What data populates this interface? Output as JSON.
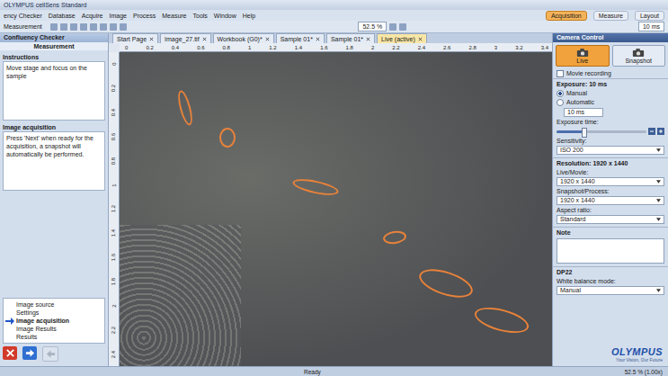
{
  "window": {
    "title": "OLYMPUS cellSens Standard"
  },
  "menu": [
    "ency Checker",
    "Database",
    "Acquire",
    "Image",
    "Process",
    "Measure",
    "Tools",
    "Window",
    "Help"
  ],
  "layout_tabs": [
    {
      "label": "Acquisition",
      "selected": true
    },
    {
      "label": "Measure",
      "selected": false
    },
    {
      "label": "Layout",
      "selected": false
    }
  ],
  "toolbar": {
    "label": "Measurement",
    "zoom": "52.5 %",
    "exposure": "10 ms"
  },
  "left_panel": {
    "title": "Confluency Checker",
    "subtitle": "Measurement",
    "sections": [
      {
        "heading": "Instructions",
        "text": "Move stage and focus on the sample"
      },
      {
        "heading": "Image acquisition",
        "text": "Press 'Next' when ready for the acquisition, a snapshot will automatically be performed."
      }
    ],
    "steps": [
      {
        "label": "Image source",
        "selected": false
      },
      {
        "label": "Settings",
        "selected": false
      },
      {
        "label": "Image acquisition",
        "selected": true
      },
      {
        "label": "Image Results",
        "selected": false
      },
      {
        "label": "Results",
        "selected": false
      }
    ],
    "nav_buttons": [
      {
        "kind": "cancel",
        "disabled": false
      },
      {
        "kind": "next",
        "disabled": false
      },
      {
        "kind": "back",
        "disabled": true
      }
    ]
  },
  "doc_tabs": [
    {
      "label": "Start Page",
      "selected": false
    },
    {
      "label": "Image_27.tif",
      "selected": false
    },
    {
      "label": "Workbook (G0)*",
      "selected": false
    },
    {
      "label": "Sample 01*",
      "selected": false
    },
    {
      "label": "Sample 01*",
      "selected": false
    },
    {
      "label": "Live (active)",
      "selected": true
    }
  ],
  "ruler": {
    "horizontal": [
      "0",
      "0.2",
      "0.4",
      "0.6",
      "0.8",
      "1",
      "1.2",
      "1.4",
      "1.6",
      "1.8",
      "2",
      "2.2",
      "2.4",
      "2.6",
      "2.8",
      "3",
      "3.2",
      "3.4"
    ],
    "vertical": [
      "0",
      "0.2",
      "0.4",
      "0.6",
      "0.8",
      "1",
      "1.2",
      "1.4",
      "1.6",
      "1.8",
      "2",
      "2.2",
      "2.4"
    ]
  },
  "camera": {
    "title": "Camera Control",
    "modes": [
      {
        "label": "Live",
        "selected": true
      },
      {
        "label": "Snapshot",
        "selected": false
      }
    ],
    "movie_recording": {
      "label": "Movie recording",
      "checked": false
    },
    "exposure": {
      "heading": "Exposure: 10 ms",
      "options": [
        {
          "label": "Manual",
          "selected": true
        },
        {
          "label": "Automatic",
          "selected": false
        }
      ],
      "value": "10 ms",
      "time_label": "Exposure time:",
      "level": 0.3
    },
    "sensitivity": {
      "label": "Sensitivity:",
      "value": "ISO 200"
    },
    "resolution": {
      "heading": "Resolution: 1920 x 1440",
      "live_label": "Live/Movie:",
      "live_value": "1920 x 1440",
      "snapshot_label": "Snapshot/Process:",
      "snapshot_value": "1920 x 1440",
      "aspect_label": "Aspect ratio:",
      "aspect_value": "Standard"
    },
    "note": {
      "heading": "Note"
    },
    "device": {
      "heading": "DP22",
      "wb_label": "White balance mode:",
      "wb_value": "Manual"
    }
  },
  "logo": {
    "brand": "OLYMPUS",
    "tagline": "Your Vision, Our Future"
  },
  "status_bar": {
    "state": "Ready",
    "zoom": "52.5 % (1.00x)"
  }
}
